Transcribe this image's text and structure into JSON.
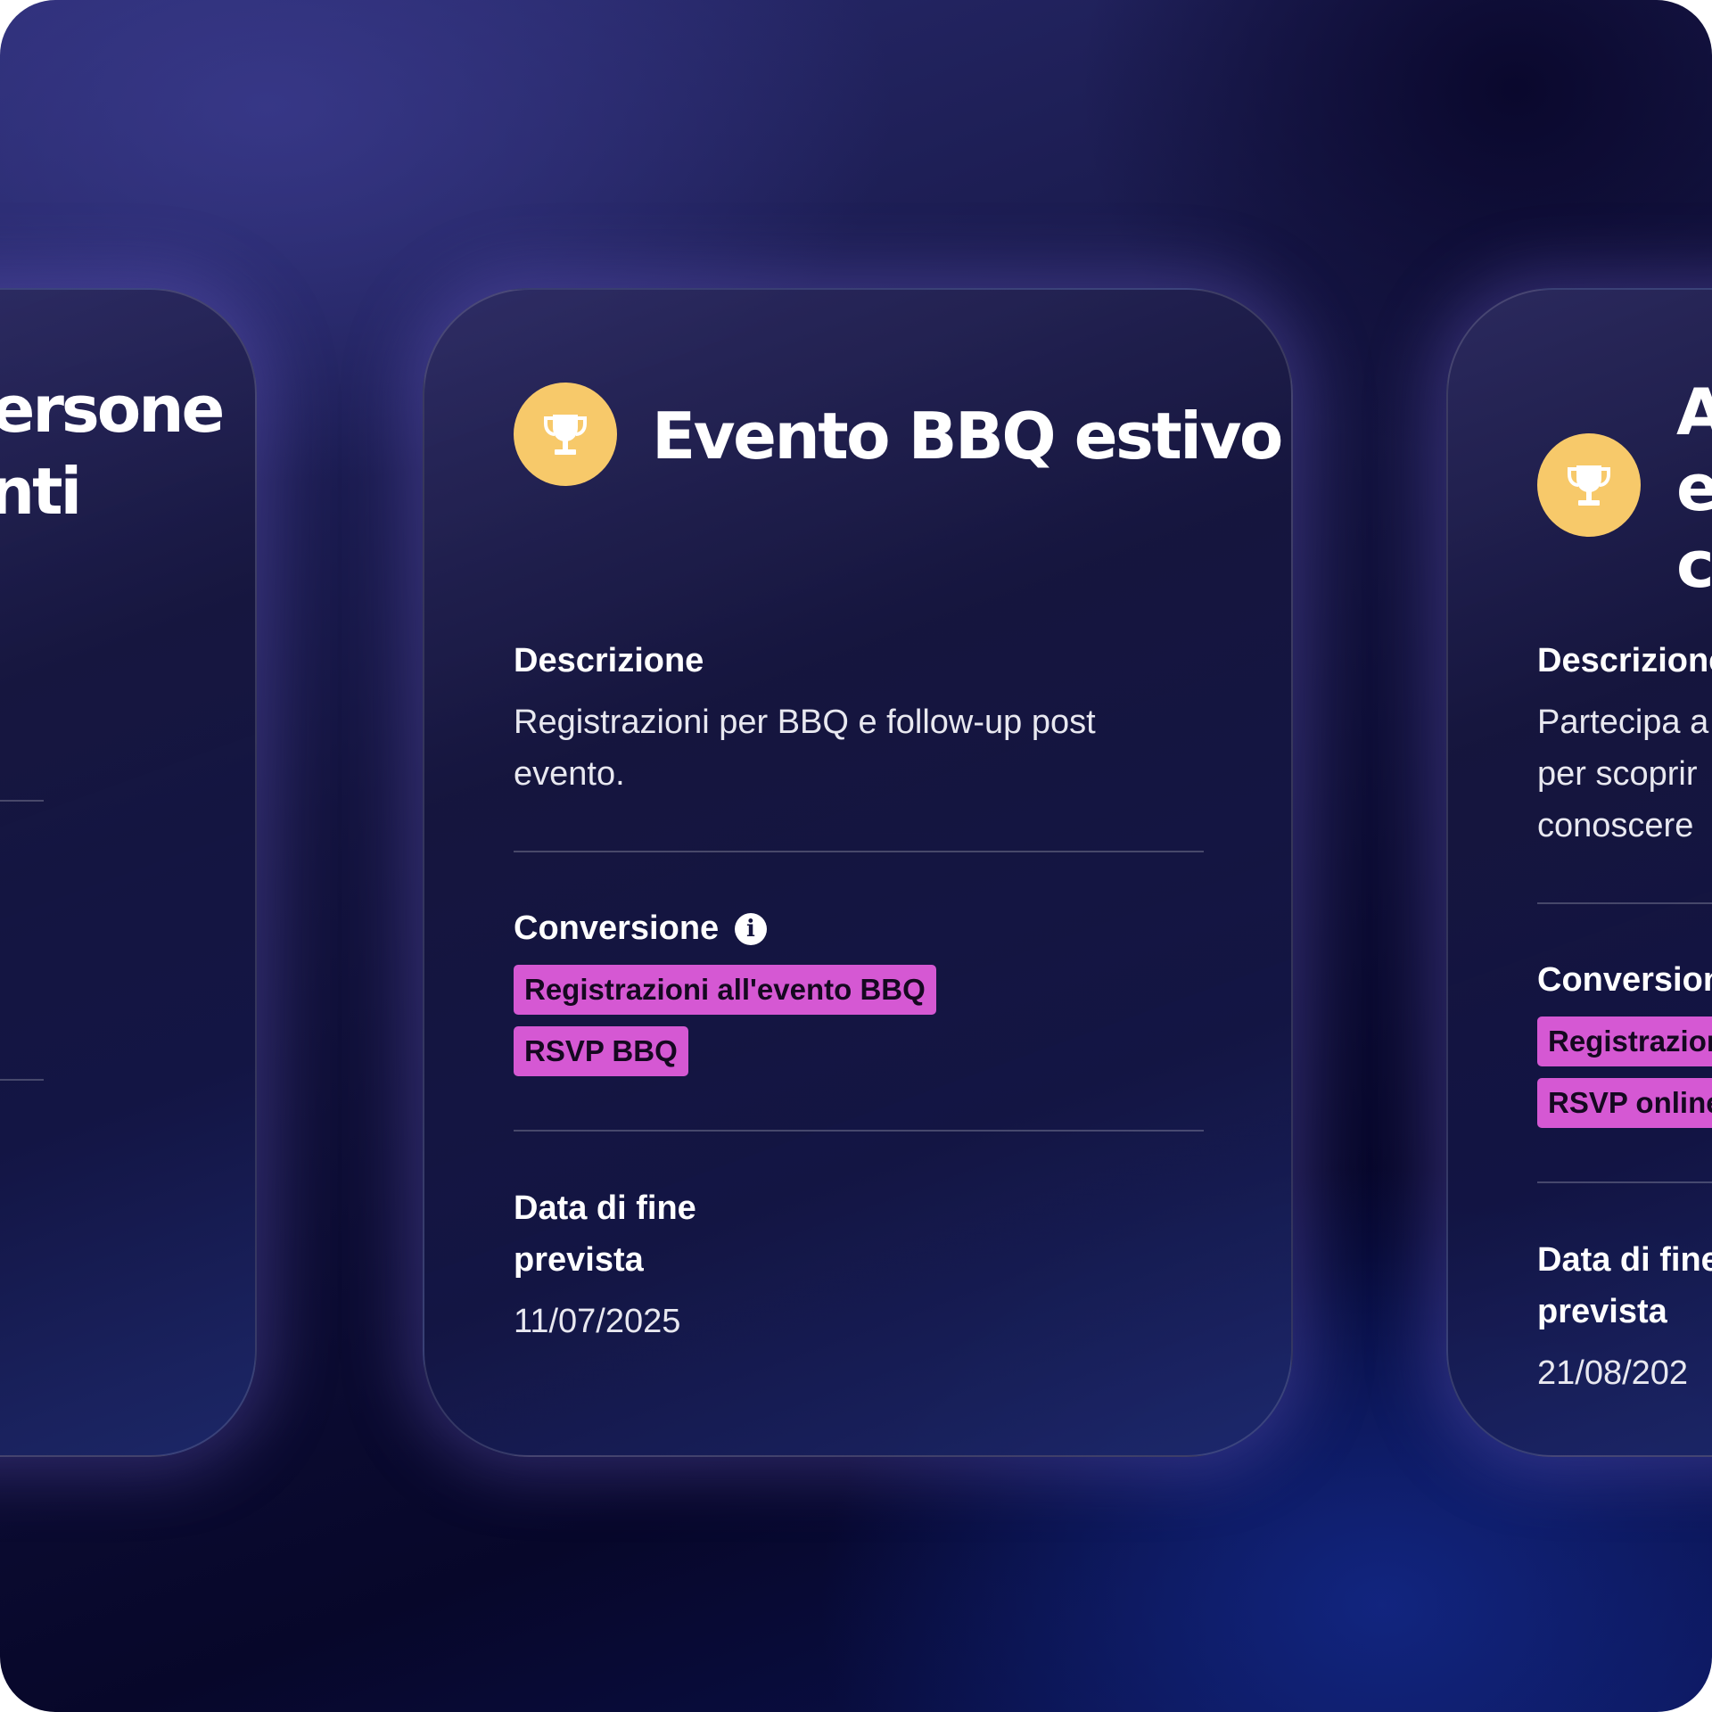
{
  "cards": {
    "left": {
      "title_lines": [
        "persone",
        "enti"
      ]
    },
    "main": {
      "title": "Evento BBQ estivo",
      "icon": "trophy-icon",
      "description_label": "Descrizione",
      "description_text_line1": "Registrazioni per BBQ e follow-up post",
      "description_text_line2": "evento.",
      "conversion_label": "Conversione",
      "conversion_info_icon": "info-icon",
      "conversion_tags": [
        "Registrazioni all'evento BBQ",
        "RSVP BBQ"
      ],
      "end_date_label_line1": "Data di fine",
      "end_date_label_line2": "prevista",
      "end_date_value": "11/07/2025"
    },
    "right": {
      "title_lines": [
        "A",
        "e",
        "c"
      ],
      "icon": "trophy-icon",
      "description_label": "Descrizione",
      "description_lines": [
        "Partecipa a",
        "per scoprir",
        "conoscere"
      ],
      "conversion_label": "Conversion",
      "conversion_tags": [
        "Registrazion",
        "RSVP online"
      ],
      "end_date_label_line1": "Data di fine",
      "end_date_label_line2": "prevista",
      "end_date_value": "21/08/202"
    }
  },
  "colors": {
    "tag_background": "#d558d3",
    "trophy_background": "#f7c96a",
    "background_dark": "#07072a"
  }
}
